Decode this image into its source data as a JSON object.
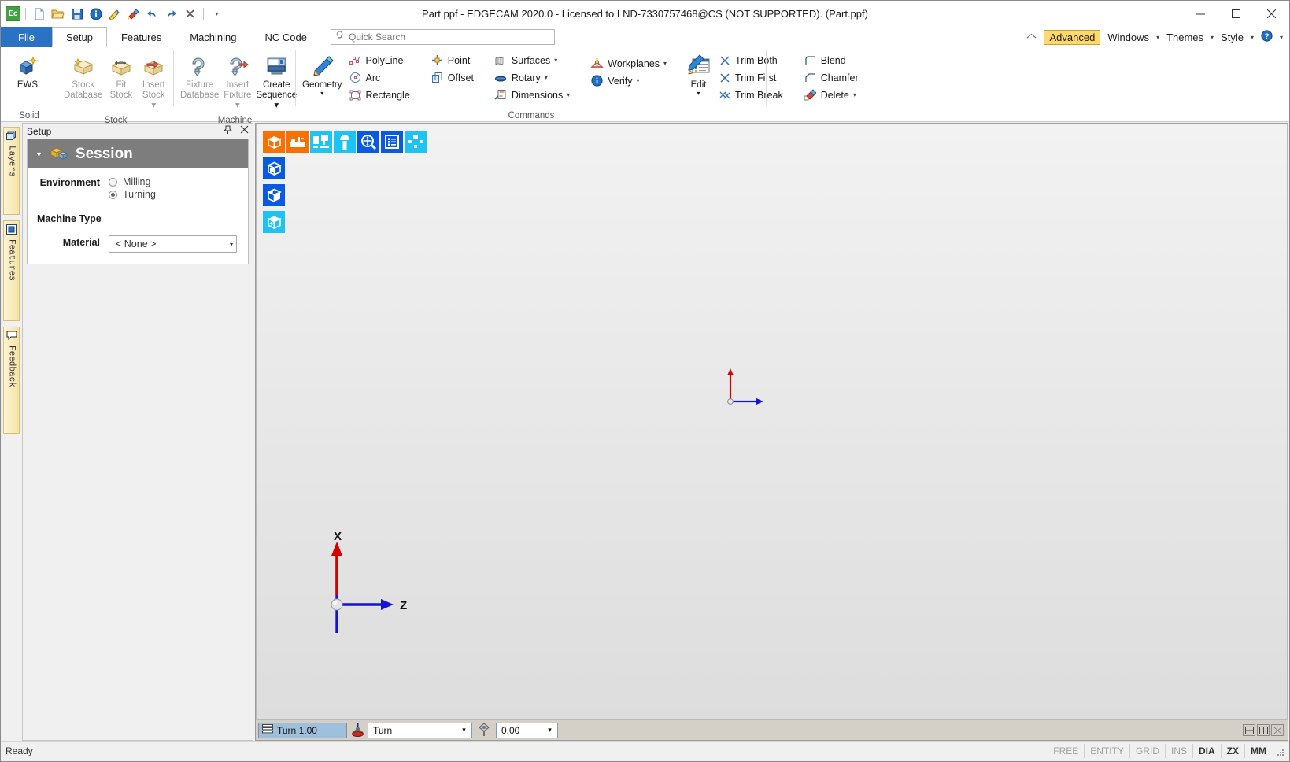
{
  "window": {
    "title": "Part.ppf - EDGECAM 2020.0  - Licensed to LND-7330757468@CS (NOT SUPPORTED). (Part.ppf)",
    "logo_text": "Ec",
    "minimize": "–",
    "maximize": "☐",
    "close": "✕"
  },
  "quick_access": [
    {
      "name": "new-icon",
      "tip": "New"
    },
    {
      "name": "open-icon",
      "tip": "Open"
    },
    {
      "name": "save-icon",
      "tip": "Save"
    },
    {
      "name": "info-icon",
      "tip": "Info"
    },
    {
      "name": "measure-icon",
      "tip": "Measure"
    },
    {
      "name": "paint-icon",
      "tip": "Paint"
    },
    {
      "name": "undo-icon",
      "tip": "Undo"
    },
    {
      "name": "redo-icon",
      "tip": "Redo"
    },
    {
      "name": "delete-icon",
      "tip": "Delete"
    },
    {
      "name": "customize-caret-icon",
      "tip": "Customize"
    }
  ],
  "tabs": [
    {
      "label": "File",
      "id": "file"
    },
    {
      "label": "Setup",
      "id": "setup",
      "active": true
    },
    {
      "label": "Features",
      "id": "features"
    },
    {
      "label": "Machining",
      "id": "machining"
    },
    {
      "label": "NC Code",
      "id": "nccode"
    }
  ],
  "search": {
    "placeholder": "Quick Search",
    "value": ""
  },
  "menu_right": {
    "home_icon": "home-icon",
    "advanced": "Advanced",
    "windows": "Windows",
    "themes": "Themes",
    "style": "Style",
    "help_icon": "help-icon",
    "caret": "▾"
  },
  "ribbon": {
    "groups": [
      {
        "title": "Solid",
        "buttons": [
          {
            "label_line1": "EWS",
            "label_line2": "",
            "icon": "ews-icon",
            "disabled": false
          }
        ]
      },
      {
        "title": "Stock",
        "buttons": [
          {
            "label_line1": "Stock",
            "label_line2": "Database",
            "icon": "stock-database-icon",
            "disabled": true
          },
          {
            "label_line1": "Fit",
            "label_line2": "Stock",
            "icon": "fit-stock-icon",
            "disabled": true
          },
          {
            "label_line1": "Insert",
            "label_line2": "Stock ▾",
            "icon": "insert-stock-icon",
            "disabled": true
          }
        ]
      },
      {
        "title": "Machine",
        "buttons": [
          {
            "label_line1": "Fixture",
            "label_line2": "Database",
            "icon": "fixture-database-icon",
            "disabled": true
          },
          {
            "label_line1": "Insert",
            "label_line2": "Fixture ▾",
            "icon": "insert-fixture-icon",
            "disabled": true
          },
          {
            "label_line1": "Create",
            "label_line2": "Sequence ▾",
            "icon": "create-sequence-icon",
            "disabled": false
          }
        ]
      }
    ],
    "commands": {
      "title": "Commands",
      "geometry": {
        "label": "Geometry",
        "caret": "▾",
        "icon": "pencil-icon"
      },
      "col1": [
        {
          "label": "PolyLine",
          "icon": "polyline-icon",
          "caret": ""
        },
        {
          "label": "Arc",
          "icon": "arc-icon",
          "caret": ""
        },
        {
          "label": "Rectangle",
          "icon": "rectangle-icon",
          "caret": ""
        }
      ],
      "col2": [
        {
          "label": "Point",
          "icon": "point-icon",
          "caret": ""
        },
        {
          "label": "Offset",
          "icon": "offset-icon",
          "caret": ""
        }
      ],
      "col3": [
        {
          "label": "Surfaces",
          "icon": "surfaces-icon",
          "caret": "▾"
        },
        {
          "label": "Rotary",
          "icon": "rotary-icon",
          "caret": "▾"
        },
        {
          "label": "Dimensions",
          "icon": "dimensions-icon",
          "caret": "▾"
        }
      ],
      "col4": [
        {
          "label": "Workplanes",
          "icon": "workplanes-icon",
          "caret": "▾"
        },
        {
          "label": "Verify",
          "icon": "verify-icon",
          "caret": "▾"
        }
      ],
      "edit": {
        "label": "Edit",
        "caret": "▾",
        "icon": "edit-icon"
      },
      "col5": [
        {
          "label": "Trim Both",
          "icon": "trim-both-icon",
          "caret": ""
        },
        {
          "label": "Trim First",
          "icon": "trim-first-icon",
          "caret": ""
        },
        {
          "label": "Trim Break",
          "icon": "trim-break-icon",
          "caret": ""
        }
      ],
      "col6": [
        {
          "label": "Blend",
          "icon": "blend-icon",
          "caret": ""
        },
        {
          "label": "Chamfer",
          "icon": "chamfer-icon",
          "caret": ""
        },
        {
          "label": "Delete",
          "icon": "delete-cmd-icon",
          "caret": "▾"
        }
      ]
    }
  },
  "sidestrip": [
    {
      "label": "Layers",
      "icon": "layers-icon"
    },
    {
      "label": "Features",
      "icon": "features-icon"
    },
    {
      "label": "Feedback",
      "icon": "feedback-icon"
    }
  ],
  "panel": {
    "header": "Setup",
    "pin_icon": "pin-icon",
    "close_icon": "close-icon",
    "session": {
      "title": "Session",
      "collapse_caret": "▼",
      "icon": "session-icon",
      "environment_label": "Environment",
      "environment_options": [
        {
          "label": "Milling",
          "selected": false
        },
        {
          "label": "Turning",
          "selected": true
        }
      ],
      "machine_type_label": "Machine Type",
      "material_label": "Material",
      "material_value": "< None >",
      "material_caret": "▾"
    }
  },
  "viewport": {
    "toolbar_row": [
      {
        "name": "solid-view-icon",
        "color": "#f77000"
      },
      {
        "name": "machine-bed-icon",
        "color": "#f77000"
      },
      {
        "name": "simulate-machine-icon",
        "color": "#1ec3f5"
      },
      {
        "name": "tool-icon",
        "color": "#1ec3f5"
      },
      {
        "name": "zoom-pan-icon",
        "color": "#0a5ae0"
      },
      {
        "name": "list-icon",
        "color": "#0a5ae0"
      },
      {
        "name": "grid-nodes-icon",
        "color": "#1ec3f5"
      }
    ],
    "toolbar_col": [
      {
        "name": "solid-box-open-icon",
        "color": "#0a5ae0"
      },
      {
        "name": "solid-box-shade-icon",
        "color": "#0a5ae0"
      },
      {
        "name": "solid-box-section-icon",
        "color": "#1ec3f5"
      }
    ],
    "axis_main": {
      "x_label": "X",
      "z_label": "Z"
    },
    "axis_origin": {
      "x_label": "",
      "z_label": ""
    },
    "status": {
      "level_icon": "level-icon",
      "level_text": "Turn 1.00",
      "workplane_icon": "workplane-icon",
      "workplane_value": "Turn",
      "depth_icon": "depth-icon",
      "depth_value": "0.00",
      "caret": "⌄",
      "right_buttons": [
        {
          "name": "split-horizontal-icon"
        },
        {
          "name": "split-vertical-icon"
        },
        {
          "name": "close-view-icon"
        }
      ]
    }
  },
  "statusbar": {
    "message": "Ready",
    "panes": [
      {
        "label": "FREE",
        "active": false
      },
      {
        "label": "ENTITY",
        "active": false
      },
      {
        "label": "GRID",
        "active": false
      },
      {
        "label": "INS",
        "active": false
      },
      {
        "label": "DIA",
        "active": true
      },
      {
        "label": "ZX",
        "active": true
      },
      {
        "label": "MM",
        "active": true
      }
    ]
  },
  "colors": {
    "accent_blue": "#2a72c4",
    "advanced_yellow": "#ffd96b",
    "session_header": "#7d7d7d",
    "orange_icon": "#f77000",
    "cyan_icon": "#1ec3f5",
    "blue_icon": "#0a5ae0",
    "axis_x": "#e00000",
    "axis_z": "#1414d2"
  }
}
